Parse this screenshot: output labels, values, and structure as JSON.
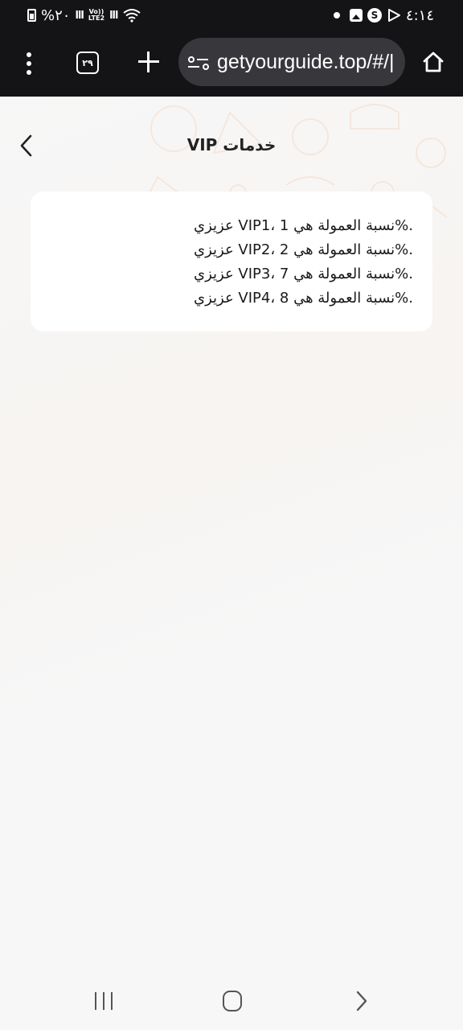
{
  "status_bar": {
    "battery_text": "%٢٠",
    "volte_top": "Vo))",
    "volte_bottom": "LTE2",
    "time": "٤:١٤"
  },
  "browser": {
    "tab_count": "٢٩",
    "url": "getyourguide.top/#/|"
  },
  "page": {
    "title": "خدمات VIP",
    "vip_lines": [
      ".%نسبة العمولة هي 1 ،VIP1 عزيزي",
      ".%نسبة العمولة هي 2 ،VIP2 عزيزي",
      ".%نسبة العمولة هي 7 ،VIP3 عزيزي",
      ".%نسبة العمولة هي 8 ،VIP4 عزيزي"
    ]
  },
  "colors": {
    "status_bg": "#141416",
    "url_bar_bg": "#38383c",
    "page_bg": "#f7f7f7",
    "card_bg": "#ffffff"
  },
  "icons": {
    "menu": "more-vertical-icon",
    "tabs": "tabs-counter-icon",
    "new_tab": "plus-icon",
    "site_settings": "tune-icon",
    "home": "home-icon",
    "back": "chevron-left-icon",
    "nav_recents": "recents-icon",
    "nav_home": "nav-home-icon",
    "nav_back": "nav-back-icon"
  }
}
